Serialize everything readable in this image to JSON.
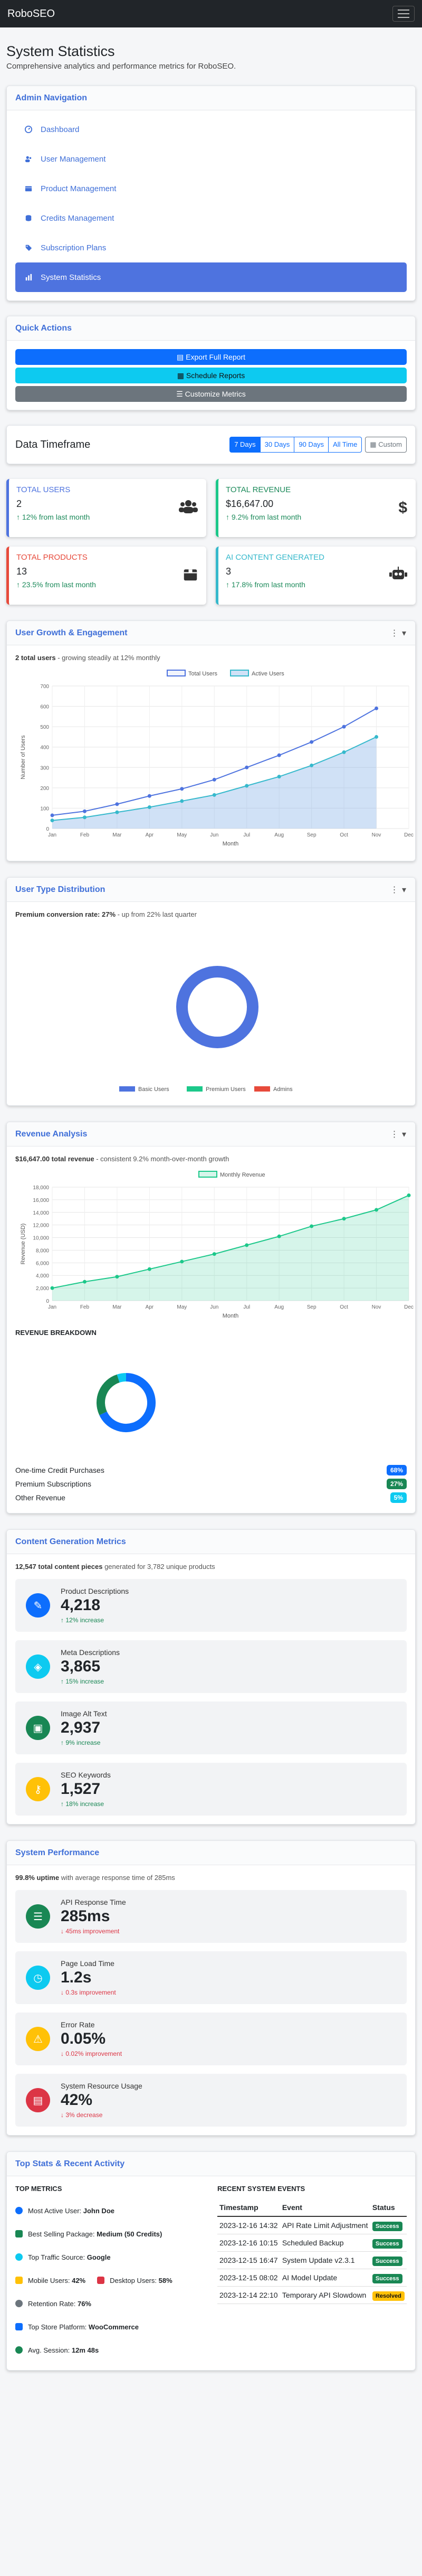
{
  "app": {
    "brand": "RoboSEO"
  },
  "page": {
    "title": "System Statistics",
    "subtitle": "Comprehensive analytics and performance metrics for RoboSEO."
  },
  "admin_nav": {
    "title": "Admin Navigation",
    "items": [
      {
        "label": "Dashboard",
        "icon": "gauge-icon"
      },
      {
        "label": "User Management",
        "icon": "users-icon"
      },
      {
        "label": "Product Management",
        "icon": "box-icon"
      },
      {
        "label": "Credits Management",
        "icon": "coins-icon"
      },
      {
        "label": "Subscription Plans",
        "icon": "tag-icon"
      },
      {
        "label": "System Statistics",
        "icon": "chart-icon",
        "active": true
      }
    ]
  },
  "quick_actions": {
    "title": "Quick Actions",
    "buttons": [
      {
        "label": "Export Full Report",
        "color": "#0d6efd"
      },
      {
        "label": "Schedule Reports",
        "color": "#0dcaf0"
      },
      {
        "label": "Customize Metrics",
        "color": "#6c757d"
      }
    ]
  },
  "timeframe": {
    "label": "Data Timeframe",
    "options": [
      "7 Days",
      "30 Days",
      "90 Days",
      "All Time"
    ],
    "active": "7 Days",
    "custom": "Custom"
  },
  "stats": [
    {
      "label": "TOTAL USERS",
      "value": "2",
      "change": "12% from last month",
      "color": "#4e73df",
      "icon": "users-icon"
    },
    {
      "label": "TOTAL REVENUE",
      "value": "$16,647.00",
      "change": "9.2% from last month",
      "color": "#1cc88a",
      "icon": "dollar-icon"
    },
    {
      "label": "TOTAL PRODUCTS",
      "value": "13",
      "change": "23.5% from last month",
      "color": "#e74a3b",
      "icon": "box-icon"
    },
    {
      "label": "AI CONTENT GENERATED",
      "value": "3",
      "change": "17.8% from last month",
      "color": "#36b9cc",
      "icon": "robot-icon"
    }
  ],
  "user_growth": {
    "title": "User Growth & Engagement",
    "highlight": "2 total users",
    "note": "growing steadily at 12% monthly"
  },
  "user_type": {
    "title": "User Type Distribution",
    "highlight": "Premium conversion rate: 27%",
    "note": "up from 22% last quarter"
  },
  "revenue": {
    "title": "Revenue Analysis",
    "highlight": "$16,647.00 total revenue",
    "note": "consistent 9.2% month-over-month growth",
    "breakdown_title": "REVENUE BREAKDOWN",
    "breakdown": [
      {
        "label": "One-time Credit Purchases",
        "pct": "68%",
        "color": "#0d6efd"
      },
      {
        "label": "Premium Subscriptions",
        "pct": "27%",
        "color": "#198754"
      },
      {
        "label": "Other Revenue",
        "pct": "5%",
        "color": "#0dcaf0"
      }
    ]
  },
  "content": {
    "title": "Content Generation Metrics",
    "highlight": "12,547 total content pieces",
    "note": "generated for 3,782 unique products",
    "items": [
      {
        "label": "Product Descriptions",
        "value": "4,218",
        "change": "12% increase",
        "color": "#0d6efd",
        "icon": "pencil-icon"
      },
      {
        "label": "Meta Descriptions",
        "value": "3,865",
        "change": "15% increase",
        "color": "#0dcaf0",
        "icon": "tag-icon"
      },
      {
        "label": "Image Alt Text",
        "value": "2,937",
        "change": "9% increase",
        "color": "#198754",
        "icon": "image-icon"
      },
      {
        "label": "SEO Keywords",
        "value": "1,527",
        "change": "18% increase",
        "color": "#ffc107",
        "icon": "key-icon"
      }
    ]
  },
  "performance": {
    "title": "System Performance",
    "highlight": "99.8% uptime",
    "note": "with average response time of 285ms",
    "items": [
      {
        "label": "API Response Time",
        "value": "285ms",
        "change": "45ms improvement",
        "color": "#198754",
        "icon": "server-icon"
      },
      {
        "label": "Page Load Time",
        "value": "1.2s",
        "change": "0.3s improvement",
        "color": "#0dcaf0",
        "icon": "clock-icon"
      },
      {
        "label": "Error Rate",
        "value": "0.05%",
        "change": "0.02% improvement",
        "color": "#ffc107",
        "icon": "warning-icon"
      },
      {
        "label": "System Resource Usage",
        "value": "42%",
        "change": "3% decrease",
        "color": "#dc3545",
        "icon": "cpu-icon"
      }
    ]
  },
  "top_stats": {
    "title": "Top Stats & Recent Activity",
    "metrics_title": "TOP METRICS",
    "events_title": "RECENT SYSTEM EVENTS",
    "metrics": [
      {
        "label": "Most Active User:",
        "value": "John Doe"
      },
      {
        "label": "Best Selling Package:",
        "value": "Medium (50 Credits)"
      },
      {
        "label": "Top Traffic Source:",
        "value": "Google"
      },
      {
        "label": "Mobile Users:",
        "value": "42%",
        "label2": "Desktop Users:",
        "value2": "58%"
      },
      {
        "label": "Retention Rate:",
        "value": "76%"
      },
      {
        "label": "Top Store Platform:",
        "value": "WooCommerce"
      },
      {
        "label": "Avg. Session:",
        "value": "12m 48s"
      }
    ],
    "columns": [
      "Timestamp",
      "Event",
      "Status"
    ],
    "events": [
      {
        "ts": "2023-12-16 14:32",
        "event": "API Rate Limit Adjustment",
        "status": "Success",
        "color": "#198754"
      },
      {
        "ts": "2023-12-16 10:15",
        "event": "Scheduled Backup",
        "status": "Success",
        "color": "#198754"
      },
      {
        "ts": "2023-12-15 16:47",
        "event": "System Update v2.3.1",
        "status": "Success",
        "color": "#198754"
      },
      {
        "ts": "2023-12-15 08:02",
        "event": "AI Model Update",
        "status": "Success",
        "color": "#198754"
      },
      {
        "ts": "2023-12-14 22:10",
        "event": "Temporary API Slowdown",
        "status": "Resolved",
        "color": "#ffc107"
      }
    ]
  },
  "chart_data": [
    {
      "type": "line",
      "title": "",
      "xlabel": "Month",
      "ylabel": "Number of Users",
      "ylim": [
        0,
        700
      ],
      "categories": [
        "Jan",
        "Feb",
        "Mar",
        "Apr",
        "May",
        "Jun",
        "Jul",
        "Aug",
        "Sep",
        "Oct",
        "Nov",
        "Dec"
      ],
      "series": [
        {
          "name": "Total Users",
          "values": [
            65,
            85,
            120,
            160,
            195,
            240,
            300,
            360,
            425,
            500,
            590,
            null
          ]
        },
        {
          "name": "Active Users",
          "values": [
            40,
            55,
            80,
            105,
            135,
            165,
            210,
            255,
            310,
            375,
            450,
            null
          ]
        }
      ],
      "yticks": [
        0,
        100,
        200,
        300,
        400,
        500,
        600,
        700
      ],
      "legend": "top"
    },
    {
      "type": "pie",
      "labels": [
        "Basic Users",
        "Premium Users",
        "Admins"
      ],
      "values": [
        2,
        0,
        0
      ],
      "colors": [
        "#4e73df",
        "#1cc88a",
        "#e74a3b"
      ],
      "legend": "bottom"
    },
    {
      "type": "area",
      "title": "",
      "xlabel": "Month",
      "ylabel": "Revenue (USD)",
      "ylim": [
        0,
        18000
      ],
      "categories": [
        "Jan",
        "Feb",
        "Mar",
        "Apr",
        "May",
        "Jun",
        "Jul",
        "Aug",
        "Sep",
        "Oct",
        "Nov",
        "Dec"
      ],
      "series": [
        {
          "name": "Monthly Revenue",
          "values": [
            2000,
            3000,
            3800,
            5000,
            6200,
            7400,
            8800,
            10200,
            11800,
            13000,
            14400,
            16700
          ]
        }
      ],
      "yticks": [
        0,
        2000,
        4000,
        6000,
        8000,
        10000,
        12000,
        14000,
        16000,
        18000
      ],
      "legend": "top"
    },
    {
      "type": "pie",
      "labels": [
        "One-time Credit Purchases",
        "Premium Subscriptions",
        "Other Revenue"
      ],
      "values": [
        68,
        27,
        5
      ],
      "colors": [
        "#0d6efd",
        "#198754",
        "#0dcaf0"
      ]
    }
  ]
}
